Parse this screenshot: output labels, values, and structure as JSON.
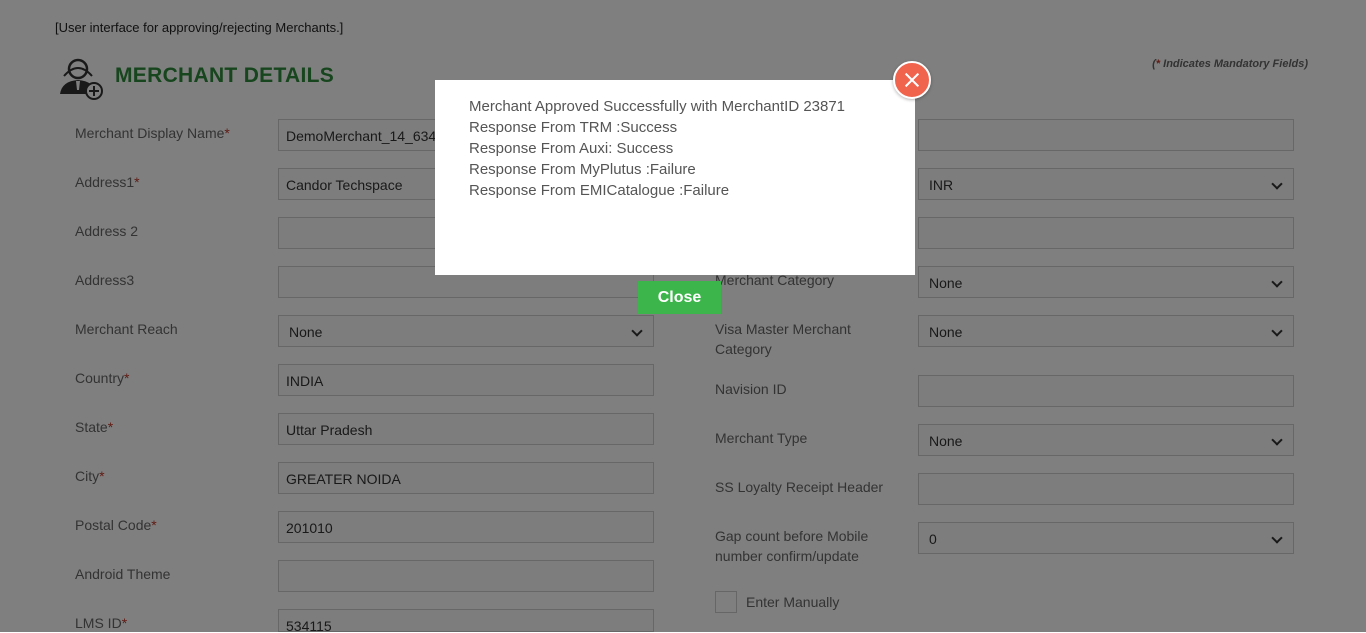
{
  "page": {
    "caption": "[User interface for approving/rejecting Merchants.]",
    "title": "MERCHANT DETAILS",
    "mandatory_star": "*",
    "mandatory_note": " Indicates Mandatory Fields)",
    "mandatory_open": "("
  },
  "left_fields": [
    {
      "label": "Merchant Display Name",
      "required": "*",
      "value": "DemoMerchant_14_634",
      "type": "text"
    },
    {
      "label": "Address1",
      "required": "*",
      "value": "Candor Techspace",
      "type": "text"
    },
    {
      "label": "Address 2",
      "required": "",
      "value": "",
      "type": "text"
    },
    {
      "label": "Address3",
      "required": "",
      "value": "",
      "type": "text"
    },
    {
      "label": "Merchant Reach",
      "required": "",
      "value": "None",
      "type": "select"
    },
    {
      "label": "Country",
      "required": "*",
      "value": "INDIA",
      "type": "text"
    },
    {
      "label": "State",
      "required": "*",
      "value": "Uttar Pradesh",
      "type": "text"
    },
    {
      "label": "City",
      "required": "*",
      "value": "GREATER NOIDA",
      "type": "text"
    },
    {
      "label": "Postal Code",
      "required": "*",
      "value": "201010",
      "type": "text"
    },
    {
      "label": "Android Theme",
      "required": "",
      "value": "",
      "type": "text"
    },
    {
      "label": "LMS ID",
      "required": "*",
      "value": "534115",
      "type": "text"
    }
  ],
  "right_fields": [
    {
      "label": "",
      "value": "",
      "type": "text"
    },
    {
      "label": "",
      "value": "INR",
      "type": "select"
    },
    {
      "label": "",
      "value": "",
      "type": "text"
    },
    {
      "label": "Merchant Category",
      "value": "None",
      "type": "select"
    },
    {
      "label": "Visa Master Merchant Category",
      "value": "None",
      "type": "select"
    },
    {
      "label": "Navision ID",
      "value": "",
      "type": "text"
    },
    {
      "label": "Merchant Type",
      "value": "None",
      "type": "select"
    },
    {
      "label": "SS Loyalty Receipt Header",
      "value": "",
      "type": "text"
    },
    {
      "label": "Gap count before Mobile number confirm/update",
      "value": "0",
      "type": "select"
    }
  ],
  "enter_manually": "Enter Manually",
  "modal": {
    "lines": [
      "Merchant Approved Successfully with MerchantID 23871",
      "Response From TRM :Success",
      "Response From Auxi: Success",
      "Response From MyPlutus :Failure",
      "Response From EMICatalogue :Failure"
    ],
    "close_label": "Close"
  },
  "colors": {
    "title_green": "#2e8b3a",
    "close_button": "#3cb54a",
    "close_x": "#f0644e",
    "required_red": "#c0392b"
  },
  "icons": [
    "add-user-icon",
    "close-icon",
    "chevron-down-icon"
  ]
}
